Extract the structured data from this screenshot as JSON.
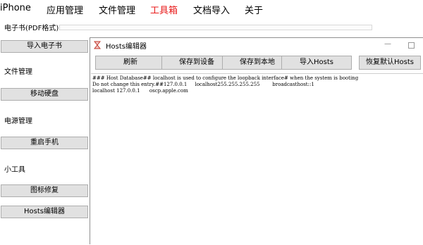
{
  "menu": {
    "items": [
      "iPhone",
      "应用管理",
      "文件管理",
      "工具箱",
      "文档导入",
      "关于"
    ],
    "active_index": 3,
    "accent_color": "#e81a1a"
  },
  "sidebar": {
    "groups": [
      {
        "label": "电子书(PDF格式)",
        "buttons": [
          "导入电子书"
        ]
      },
      {
        "label": "文件管理",
        "buttons": [
          "移动硬盘"
        ]
      },
      {
        "label": "电源管理",
        "buttons": [
          "重启手机"
        ]
      },
      {
        "label": "小工具",
        "buttons": [
          "图标修复",
          "Hosts编辑器"
        ]
      }
    ]
  },
  "dialog": {
    "title": "Hosts编辑器",
    "icon": "hourglass-icon",
    "toolbar": {
      "refresh": "刷新",
      "save_device": "保存到设备",
      "save_local": "保存到本地",
      "import_hosts": "导入Hosts",
      "restore_default": "恢复默认Hosts"
    },
    "hosts_lines": [
      "### Host Database## localhost is used to configure the loopback interface# when the system is booting",
      "Do not change this entry.##127.0.0.1     localhost255.255.255.255        broadcasthost::1",
      "localhost 127.0.0.1      oscp.apple.com"
    ]
  }
}
